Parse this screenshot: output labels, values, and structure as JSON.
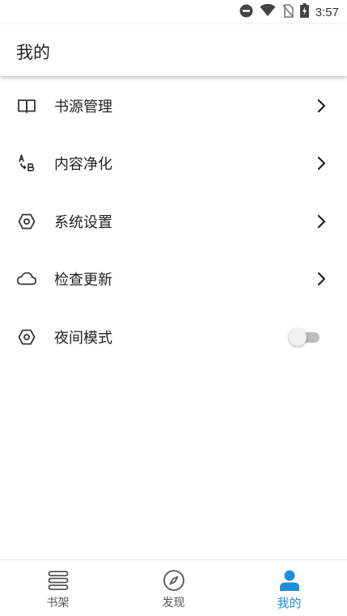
{
  "status_bar": {
    "time": "3:57",
    "icons": [
      "do-not-disturb-icon",
      "wifi-icon",
      "no-sim-icon",
      "battery-charging-icon"
    ]
  },
  "app_bar": {
    "title": "我的"
  },
  "menu": {
    "items": [
      {
        "label": "书源管理",
        "icon": "book-open-icon",
        "trailing": "chevron-right-icon"
      },
      {
        "label": "内容净化",
        "icon": "replace-ab-icon",
        "trailing": "chevron-right-icon"
      },
      {
        "label": "系统设置",
        "icon": "hex-nut-icon",
        "trailing": "chevron-right-icon"
      },
      {
        "label": "检查更新",
        "icon": "cloud-icon",
        "trailing": "chevron-right-icon"
      },
      {
        "label": "夜间模式",
        "icon": "hex-nut-icon",
        "trailing": "toggle",
        "toggle_on": false
      }
    ]
  },
  "bottom_nav": {
    "items": [
      {
        "label": "书架",
        "icon": "bookshelf-icon",
        "active": false
      },
      {
        "label": "发现",
        "icon": "compass-icon",
        "active": false
      },
      {
        "label": "我的",
        "icon": "person-icon",
        "active": true
      }
    ]
  },
  "colors": {
    "accent": "#1f8ed8",
    "text": "#222222",
    "icon": "#333333",
    "toggle_track": "#bdbdbd"
  }
}
